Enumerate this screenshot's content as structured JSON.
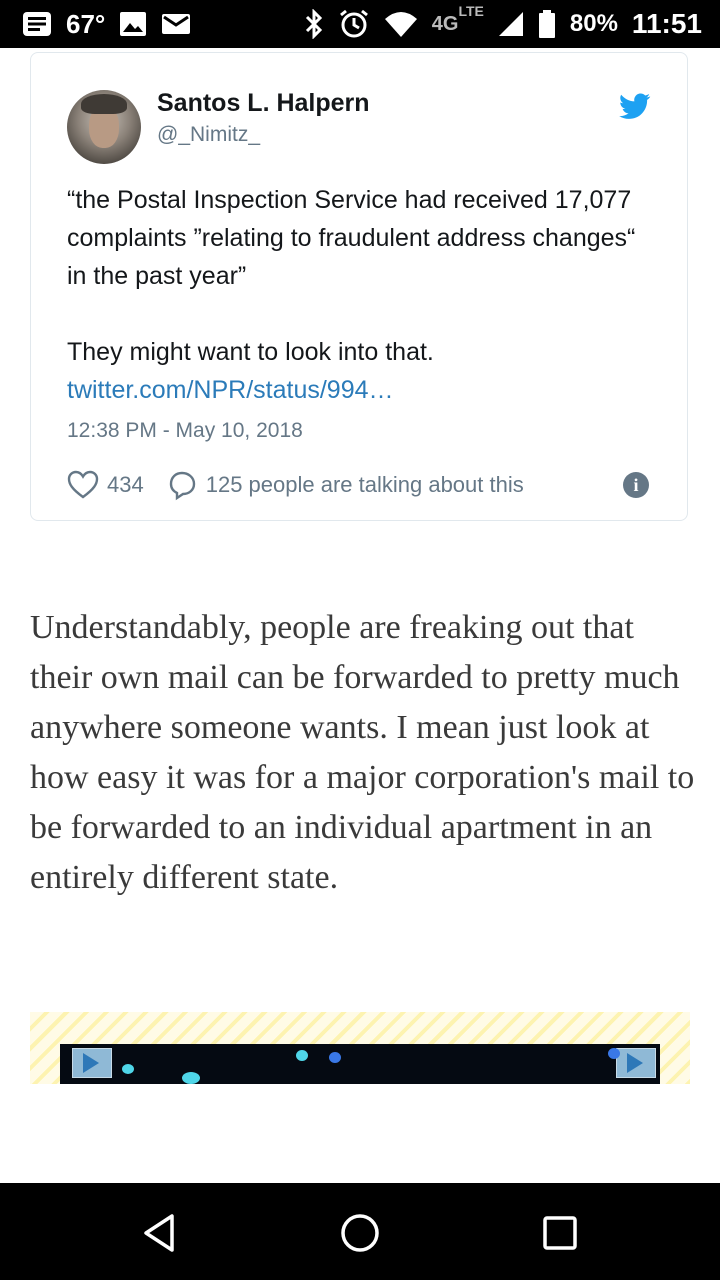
{
  "status_bar": {
    "temperature": "67°",
    "network": "4G",
    "network_sub": "LTE",
    "battery": "80%",
    "time": "11:51",
    "icons": [
      "notification-icon",
      "image-icon",
      "mail-icon",
      "bluetooth-icon",
      "alarm-icon",
      "wifi-icon",
      "signal-icon",
      "battery-icon"
    ]
  },
  "tweet": {
    "author_name": "Santos L. Halpern",
    "author_handle": "@_Nimitz_",
    "text_line1": "“the Postal Inspection Service had received 17,077 complaints ”relating to fraudulent address changes“ in the past year”",
    "text_line2": "They might want to look into that.",
    "link": "twitter.com/NPR/status/994…",
    "timestamp": "12:38 PM - May 10, 2018",
    "likes": "434",
    "talking": "125 people are talking about this",
    "brand_color": "#1da1f2"
  },
  "article": {
    "paragraph": "Understandably, people are freaking out that their own mail can be forwarded to pretty much anywhere someone wants. I mean just look at how easy it was for a major corporation's mail to be forwarded to an individual apartment in an entirely different state."
  },
  "nav_bar": {
    "buttons": [
      "back-icon",
      "home-icon",
      "recents-icon"
    ]
  }
}
